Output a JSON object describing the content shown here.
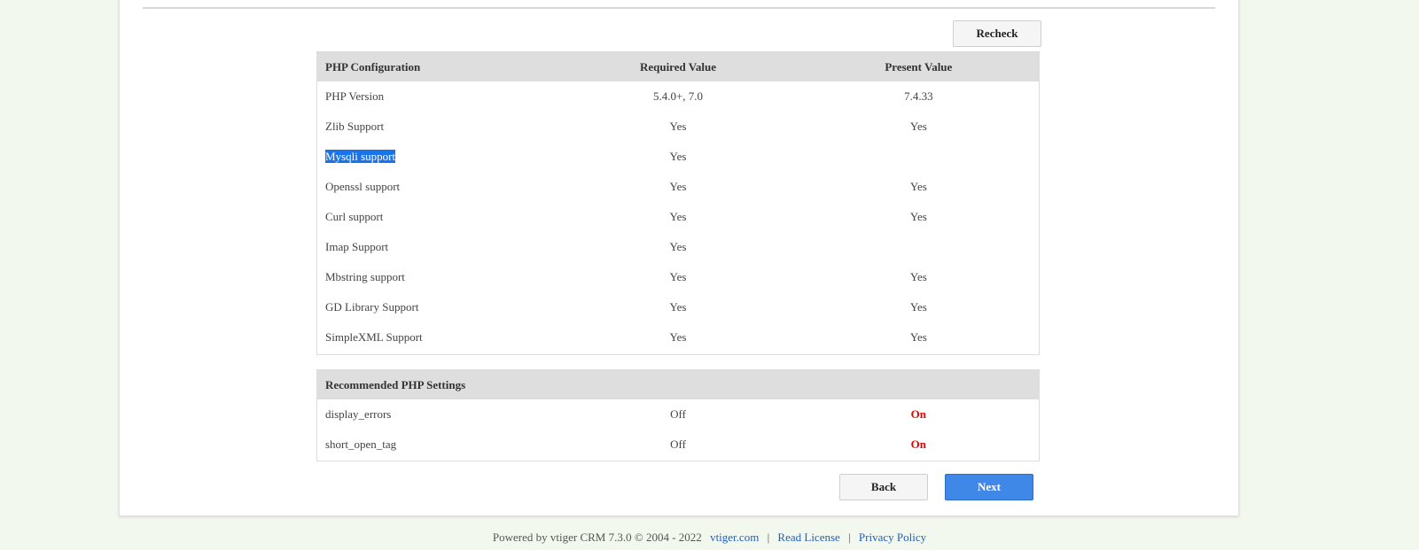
{
  "actions": {
    "recheck_label": "Recheck",
    "back_label": "Back",
    "next_label": "Next"
  },
  "php_config": {
    "headers": [
      "PHP Configuration",
      "Required Value",
      "Present Value"
    ],
    "rows": [
      {
        "name": "PHP Version",
        "required": "5.4.0+, 7.0",
        "present": "7.4.33"
      },
      {
        "name": "Zlib Support",
        "required": "Yes",
        "present": "Yes"
      },
      {
        "name": "Mysqli support",
        "required": "Yes",
        "present": ""
      },
      {
        "name": "Openssl support",
        "required": "Yes",
        "present": "Yes"
      },
      {
        "name": "Curl support",
        "required": "Yes",
        "present": "Yes"
      },
      {
        "name": "Imap Support",
        "required": "Yes",
        "present": ""
      },
      {
        "name": "Mbstring support",
        "required": "Yes",
        "present": "Yes"
      },
      {
        "name": "GD Library Support",
        "required": "Yes",
        "present": "Yes"
      },
      {
        "name": "SimpleXML Support",
        "required": "Yes",
        "present": "Yes"
      }
    ]
  },
  "recommended": {
    "header": "Recommended PHP Settings",
    "rows": [
      {
        "name": "display_errors",
        "required": "Off",
        "present": "On"
      },
      {
        "name": "short_open_tag",
        "required": "Off",
        "present": "On"
      }
    ]
  },
  "footer": {
    "powered_by": "Powered by vtiger CRM 7.3.0  © 2004 - 2022",
    "link_site": "vtiger.com",
    "sep": "|",
    "link_license": "Read License",
    "link_privacy": "Privacy Policy"
  },
  "colors": {
    "primary_button": "#3f88e8",
    "warning_text": "#e60000",
    "selection": "#1a73e8",
    "page_background": "#f3f8ee"
  }
}
